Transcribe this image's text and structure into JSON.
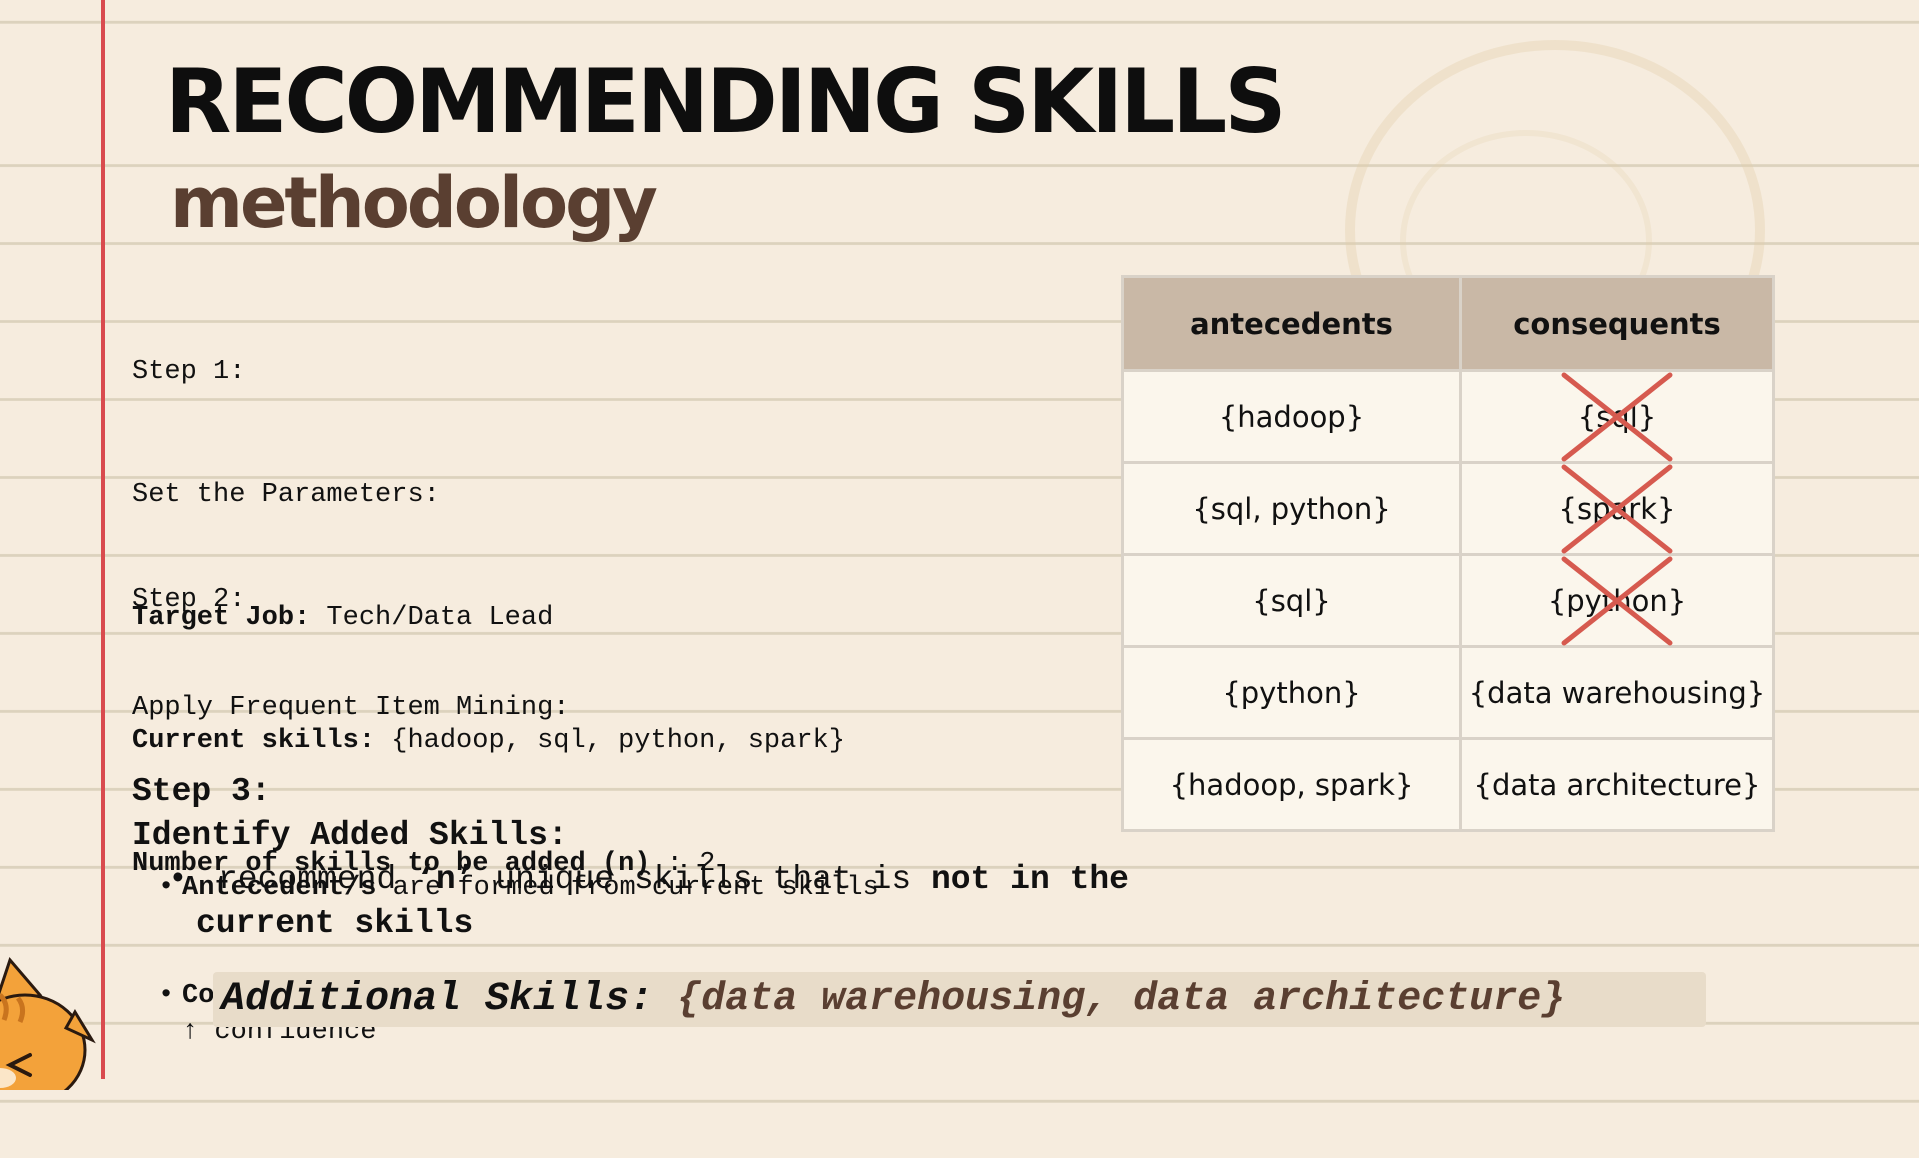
{
  "slide": {
    "title": "RECOMMENDING SKILLS",
    "subtitle": "methodology"
  },
  "step1": {
    "heading": "Step 1:",
    "subheading": "Set the Parameters:",
    "target_job_label": "Target Job:",
    "target_job_value": " Tech/Data Lead",
    "current_skills_label": "Current skills:",
    "current_skills_value": " {hadoop, sql, python, spark}",
    "n_label": "Number of skills to be added (n)",
    "n_value": " : 2"
  },
  "step2": {
    "heading": "Step 2:",
    "subheading": "Apply Frequent Item Mining:",
    "bullet1_bold": "Antecedent/s",
    "bullet1_text": " are formed from current skills",
    "bullet2_bold": "Consequent/s",
    "bullet2_text": " are based on ↑ lift and ↑ confidence"
  },
  "step3": {
    "heading": "Step 3:",
    "subheading": "Identify Added Skills:",
    "rec_text": "recommend ",
    "rec_n": "‘n’",
    "rec_text2": " unique skills that is ",
    "rec_bold": "not in the",
    "rec_line2": "current skills"
  },
  "additional": {
    "label": "Additional Skills: ",
    "value": "{data warehousing, data architecture}"
  },
  "table": {
    "headers": [
      "antecedents",
      "consequents"
    ],
    "rows": [
      {
        "antecedent": "{hadoop}",
        "consequent": "{sql}",
        "crossed_out": true
      },
      {
        "antecedent": "{sql, python}",
        "consequent": "{spark}",
        "crossed_out": true
      },
      {
        "antecedent": "{sql}",
        "consequent": "{python}",
        "crossed_out": true
      },
      {
        "antecedent": "{python}",
        "consequent": "{data warehousing}",
        "crossed_out": false
      },
      {
        "antecedent": "{hadoop, spark}",
        "consequent": "{data architecture}",
        "crossed_out": false
      }
    ]
  },
  "colors": {
    "background": "#f6ecde",
    "margin_line": "#d94b4f",
    "subtitle": "#5a3f31",
    "table_header": "#c9b8a6",
    "cross_mark": "#d65a4f"
  }
}
